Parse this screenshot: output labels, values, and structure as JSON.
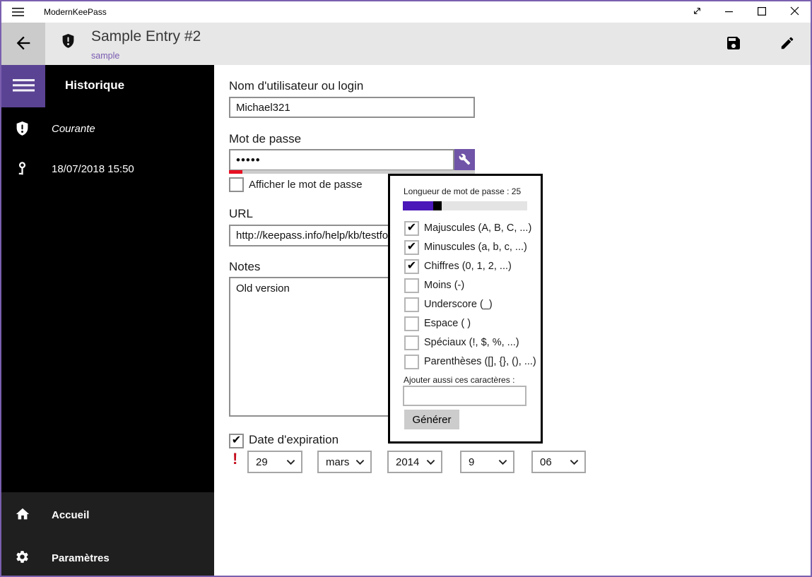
{
  "titlebar": {
    "app_title": "ModernKeePass"
  },
  "header": {
    "title": "Sample Entry #2",
    "subtitle": "sample"
  },
  "sidebar": {
    "section_title": "Historique",
    "items": [
      {
        "icon": "shield-exclamation-icon",
        "label": "Courante"
      },
      {
        "icon": "key-icon",
        "label": "18/07/2018 15:50"
      }
    ],
    "footer_items": [
      {
        "icon": "home-icon",
        "label": "Accueil"
      },
      {
        "icon": "gear-icon",
        "label": "Paramètres"
      }
    ]
  },
  "form": {
    "username_label": "Nom d'utilisateur ou login",
    "username_value": "Michael321",
    "password_label": "Mot de passe",
    "password_value": "•••••",
    "show_password_label": "Afficher le mot de passe",
    "show_password_checked": false,
    "show_password_glyph": "",
    "url_label": "URL",
    "url_value": "http://keepass.info/help/kb/testfo",
    "notes_label": "Notes",
    "notes_value": "Old version",
    "expiration_label": "Date d'expiration",
    "expiration_checked": true,
    "expiration_glyph": "✔",
    "expiration_warning": "!",
    "date_parts": [
      {
        "name": "day",
        "value": "29"
      },
      {
        "name": "month",
        "value": "mars"
      },
      {
        "name": "year",
        "value": "2014"
      },
      {
        "name": "hour",
        "value": "9"
      },
      {
        "name": "minute",
        "value": "06"
      }
    ]
  },
  "generator": {
    "length_label": "Longueur de mot de passe : 25",
    "length_value": 25,
    "slider_percent": 25,
    "options": [
      {
        "label": "Majuscules (A, B, C, ...)",
        "checked": true,
        "glyph": "✔"
      },
      {
        "label": "Minuscules (a, b, c, ...)",
        "checked": true,
        "glyph": "✔"
      },
      {
        "label": "Chiffres (0, 1, 2, ...)",
        "checked": true,
        "glyph": "✔"
      },
      {
        "label": "Moins (-)",
        "checked": false,
        "glyph": ""
      },
      {
        "label": "Underscore (_)",
        "checked": false,
        "glyph": ""
      },
      {
        "label": "Espace ( )",
        "checked": false,
        "glyph": ""
      },
      {
        "label": "Spéciaux (!, $, %, ...)",
        "checked": false,
        "glyph": ""
      },
      {
        "label": "Parenthèses ([], {}, (), ...)",
        "checked": false,
        "glyph": ""
      }
    ],
    "custom_label": "Ajouter aussi ces caractères :",
    "custom_value": "",
    "generate_label": "Générer"
  },
  "colors": {
    "window_border_purple": "#7a5fae",
    "accent_purple": "#5b4394",
    "wrench_button_purple": "#7054a8",
    "slider_purple": "#4a17b8",
    "subtitle_purple": "#7a5bb2",
    "strength_red": "#e81123",
    "warning_red": "#c50f1f"
  }
}
